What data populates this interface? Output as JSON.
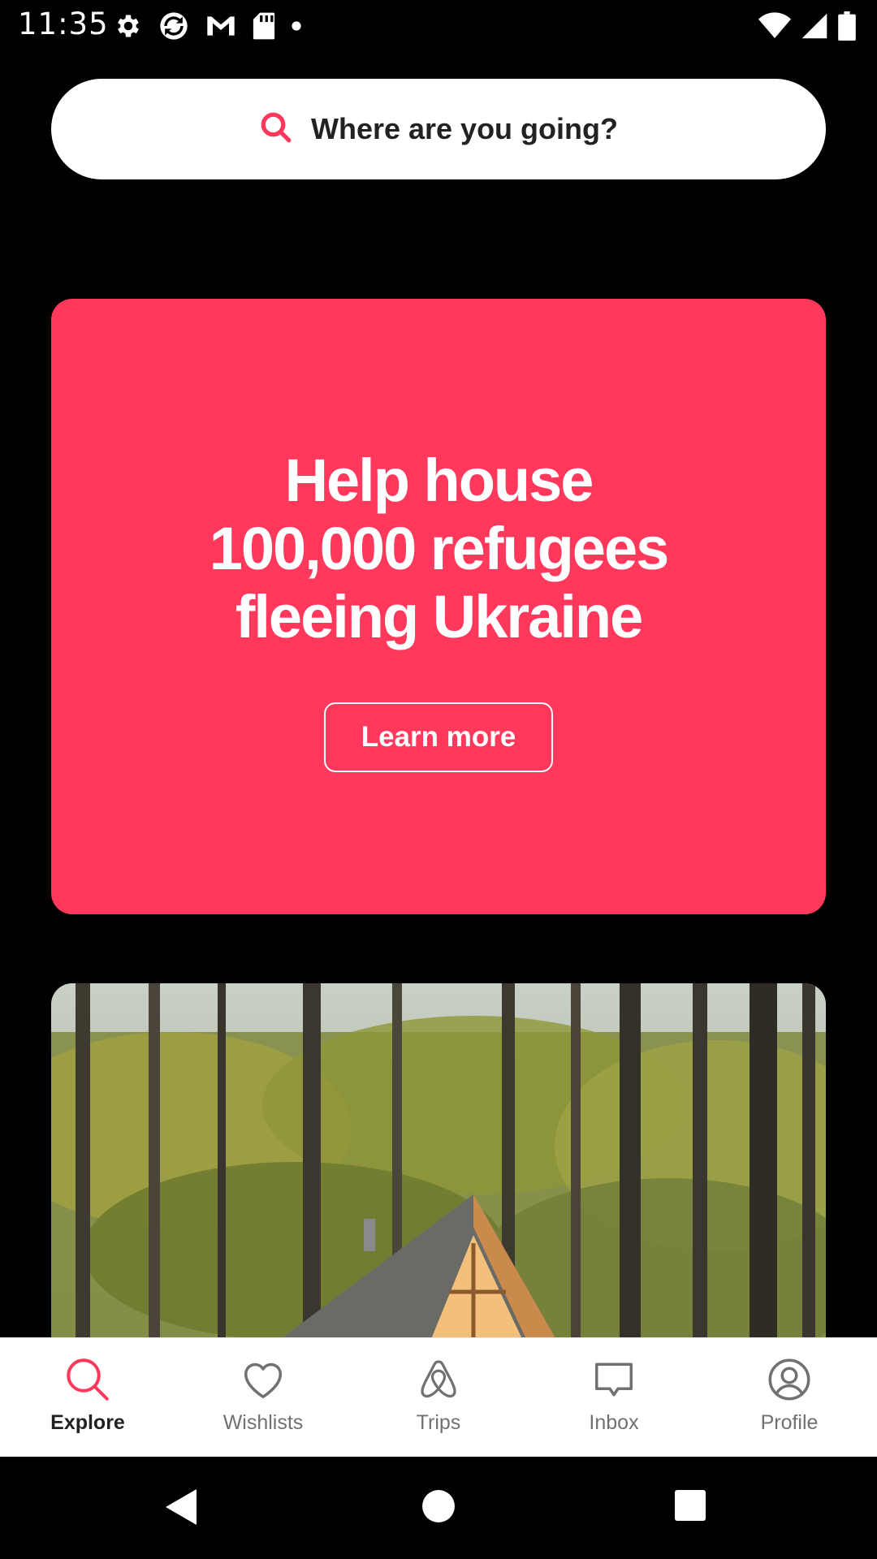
{
  "status_bar": {
    "time": "11:35",
    "left_icons": [
      "settings-icon",
      "sync-icon",
      "gmail-icon",
      "sd-card-icon",
      "dot-icon"
    ],
    "right_icons": [
      "wifi-icon",
      "cellular-signal-icon",
      "battery-icon"
    ]
  },
  "search": {
    "placeholder": "Where are you going?",
    "icon": "search-icon",
    "accent_color": "#ff385c"
  },
  "promo": {
    "title": "Help house 100,000 refugees fleeing Ukraine",
    "button_label": "Learn more",
    "background_color": "#ff385c"
  },
  "listing": {
    "image": "a-frame-cabin-in-forest-photo"
  },
  "bottom_nav": {
    "items": [
      {
        "label": "Explore",
        "icon": "search-icon",
        "active": true
      },
      {
        "label": "Wishlists",
        "icon": "heart-icon",
        "active": false
      },
      {
        "label": "Trips",
        "icon": "airbnb-logo-icon",
        "active": false
      },
      {
        "label": "Inbox",
        "icon": "message-icon",
        "active": false
      },
      {
        "label": "Profile",
        "icon": "profile-icon",
        "active": false
      }
    ],
    "active_color": "#ff385c",
    "inactive_color": "#717171"
  },
  "system_nav": {
    "buttons": [
      "back-icon",
      "home-icon",
      "recents-icon"
    ]
  }
}
